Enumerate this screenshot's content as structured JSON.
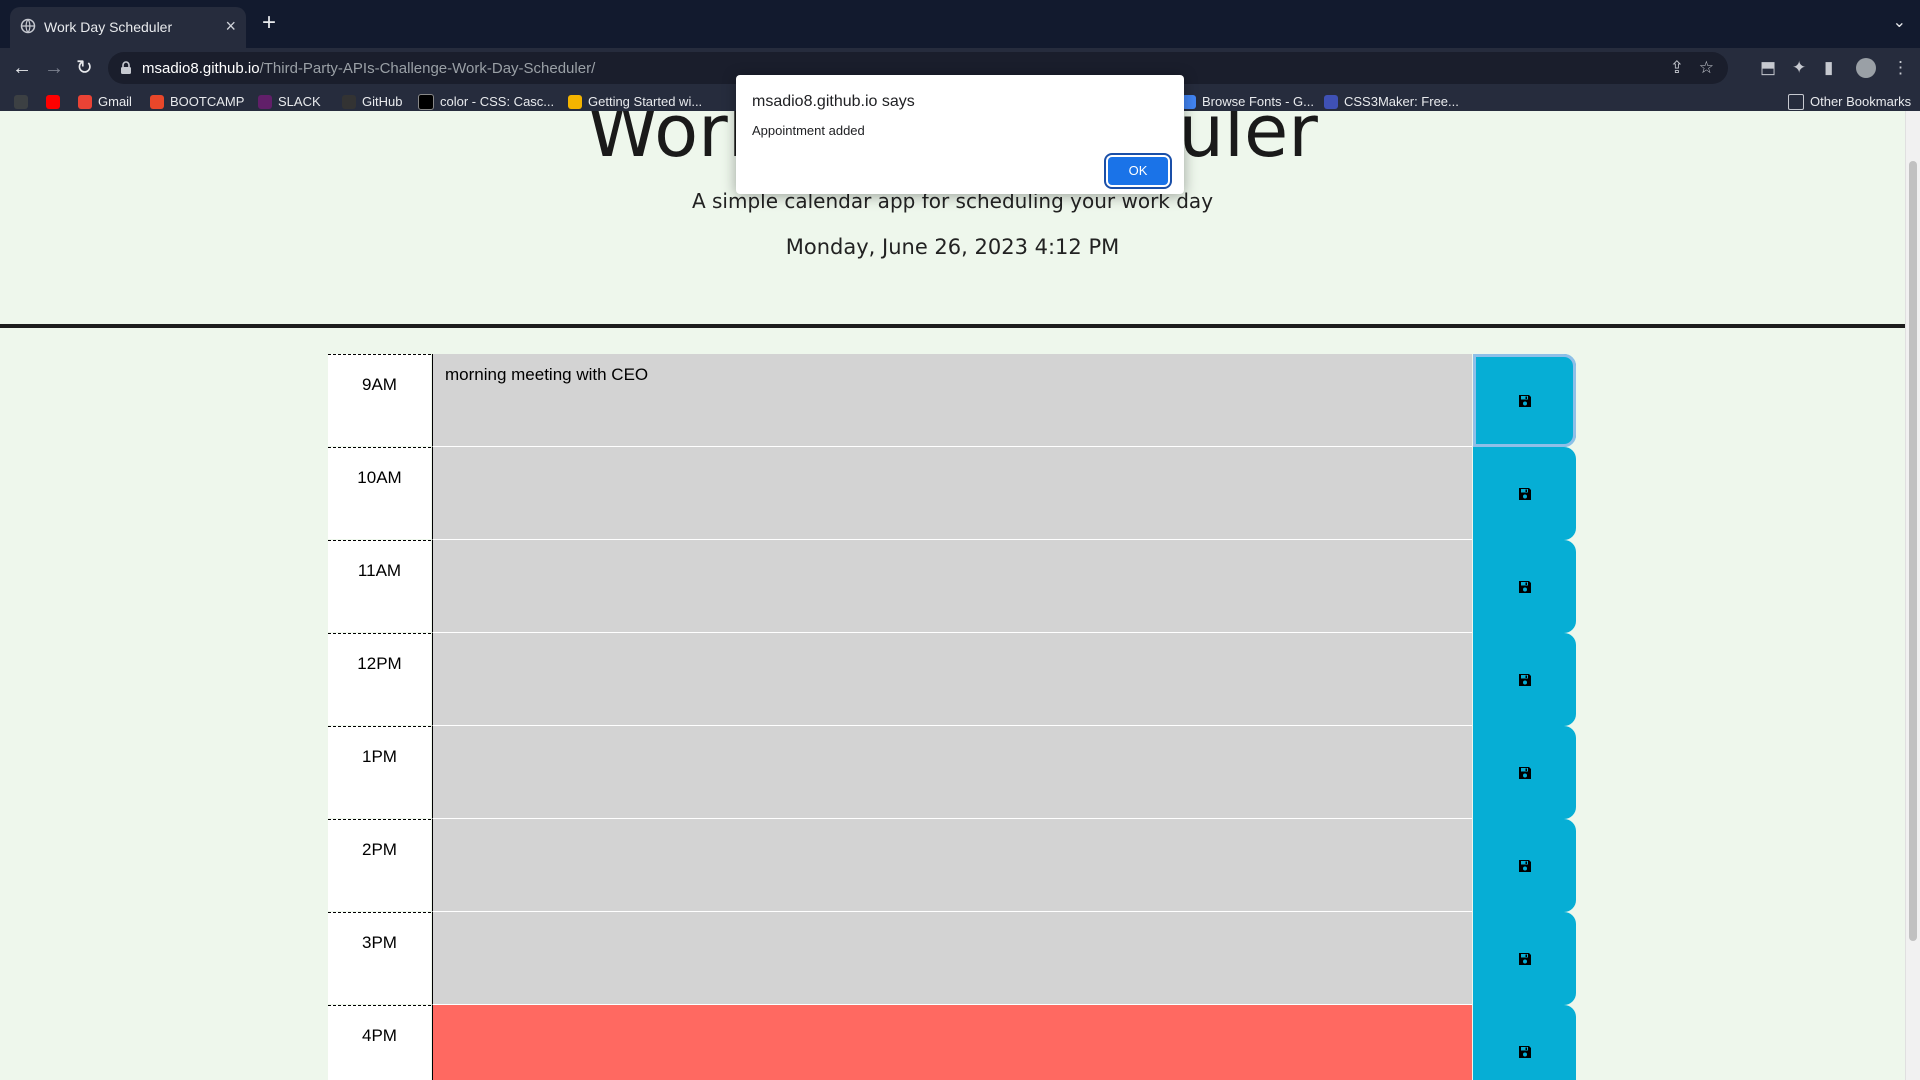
{
  "browser": {
    "tab_title": "Work Day Scheduler",
    "url_host": "msadio8.github.io",
    "url_path": "/Third-Party-APIs-Challenge-Work-Day-Scheduler/",
    "bookmarks": [
      {
        "label": "Gmail",
        "color": "#ea4335"
      },
      {
        "label": "BOOTCAMP",
        "color": "#e8472a"
      },
      {
        "label": "SLACK",
        "color": "#4a154b"
      },
      {
        "label": "GitHub",
        "color": "#333333"
      },
      {
        "label": "color - CSS: Casc...",
        "color": "#000000"
      },
      {
        "label": "Getting Started wi...",
        "color": "#f4b400"
      },
      {
        "label": "Browse Fonts - G...",
        "color": "#4285f4"
      },
      {
        "label": "CSS3Maker: Free...",
        "color": "#3f51b5"
      }
    ],
    "other_bookmarks": "Other Bookmarks"
  },
  "header": {
    "title": "Work Day Scheduler",
    "subtitle": "A simple calendar app for scheduling your work day",
    "current_date": "Monday, June 26, 2023 4:12 PM"
  },
  "schedule": [
    {
      "hour": "9AM",
      "text": "morning meeting with CEO",
      "state": "past"
    },
    {
      "hour": "10AM",
      "text": "",
      "state": "past"
    },
    {
      "hour": "11AM",
      "text": "",
      "state": "past"
    },
    {
      "hour": "12PM",
      "text": "",
      "state": "past"
    },
    {
      "hour": "1PM",
      "text": "",
      "state": "past"
    },
    {
      "hour": "2PM",
      "text": "",
      "state": "past"
    },
    {
      "hour": "3PM",
      "text": "",
      "state": "past"
    },
    {
      "hour": "4PM",
      "text": "",
      "state": "present"
    }
  ],
  "dialog": {
    "title": "msadio8.github.io says",
    "message": "Appointment added",
    "ok_label": "OK"
  },
  "colors": {
    "past": "#d3d3d3",
    "present": "#ff6961",
    "save_button": "#06aed5",
    "page_background": "#eef7ec"
  }
}
